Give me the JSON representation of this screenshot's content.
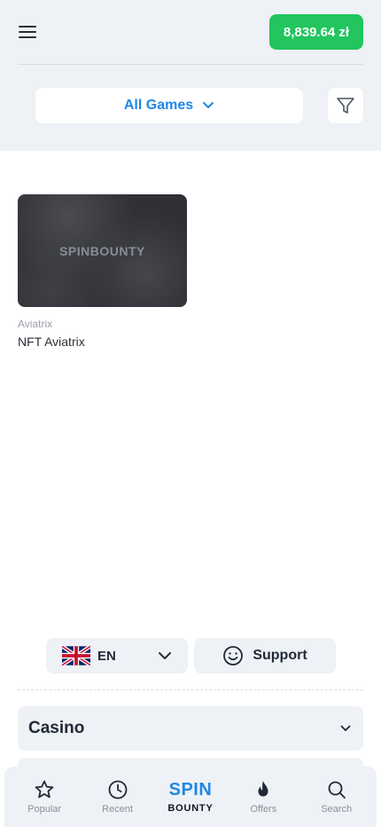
{
  "header": {
    "balance": "8,839.64 zł"
  },
  "filters": {
    "games_label": "All Games"
  },
  "games": [
    {
      "thumb_logo": "SPINBOUNTY",
      "provider": "Aviatrix",
      "title": "NFT Aviatrix"
    }
  ],
  "footer": {
    "language": "EN",
    "support_label": "Support",
    "casino_label": "Casino"
  },
  "bottom_nav": {
    "popular": "Popular",
    "recent": "Recent",
    "brand_top": "SPIN",
    "brand_bottom": "BOUNTY",
    "offers": "Offers",
    "search": "Search"
  },
  "colors": {
    "accent_blue": "#1e88e5",
    "balance_green": "#22c55e",
    "panel_gray": "#eef1f5"
  },
  "icons": [
    "hamburger-menu-icon",
    "chevron-down-icon",
    "filter-icon",
    "uk-flag-icon",
    "smiley-icon",
    "star-icon",
    "clock-icon",
    "flame-icon",
    "search-icon"
  ]
}
